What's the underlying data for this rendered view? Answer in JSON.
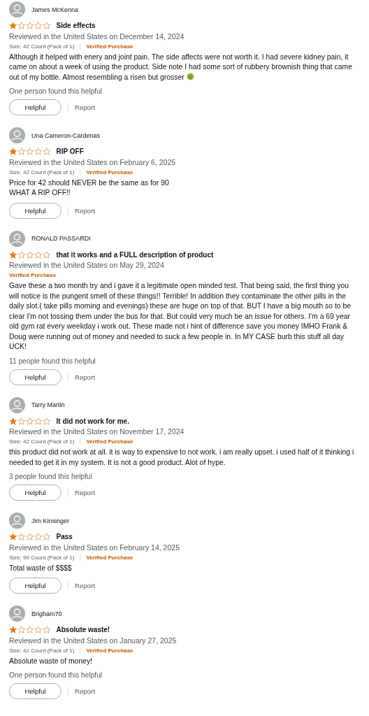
{
  "reviews": [
    {
      "name": "James McKenna",
      "stars": 1,
      "title": "Side effects",
      "date": "Reviewed in the United States on December 14, 2024",
      "size": "Size: 42 Count (Pack of 1)",
      "badge": "Verified Purchase",
      "body": "Although it helped with enery and joint pain. The side affects were not worth it. I had severe kidney pain, it came on about a week of using the product. Side note I had some sort of rubbery brownish thing that came out of my bottle. Almost resembling a risen but grosser",
      "sick_face": true,
      "helpful_count": "One person found this helpful",
      "helpful_button": "Helpful",
      "report_link": "Report"
    },
    {
      "name": "Una Cameron-Cardenas",
      "stars": 1,
      "title": "RIP OFF",
      "date": "Reviewed in the United States on February 6, 2025",
      "size": "Size: 42 Count (Pack of 1)",
      "badge": "Verified Purchase",
      "body": "Price for 42 should NEVER be the same as for 90\nWHAT A RIP OFF!!",
      "helpful_button": "Helpful",
      "report_link": "Report"
    },
    {
      "name": "RONALD PASSARDI",
      "stars": 1,
      "title": "that it works and a FULL description of product",
      "date": "Reviewed in the United States on May 29, 2024",
      "badge": "Verified Purchase",
      "body": "Gave these a two month try and i gave it a legitimate open minded test. That being said, the first thing you will notice is the pungent smell of these things!! Terrible! In addition they contaminate the other pills in the daily slot.( take pills morning and evenings) these are huge on top of that. BUT I have a big mouth so to be clear I'm not tossing them under the bus for that. But could very much be an issue for others. I'm a 69 year old gym rat every weekday i work out. These made not i hint of difference save you money IMHO Frank & Doug were running out of money and needed to suck a few people in. In MY CASE burb this stuff all day UCK!",
      "helpful_count": "11 people found this helpful",
      "helpful_button": "Helpful",
      "report_link": "Report"
    },
    {
      "name": "Tarry Martin",
      "stars": 1,
      "title": "It did not work for me.",
      "date": "Reviewed in the United States on November 17, 2024",
      "size": "Size: 42 Count (Pack of 1)",
      "badge": "Verified Purchase",
      "body": "this product did not work at all. it is way to expensive to not work. i am really upset. i used half of it thinking i needed to get it in my system. It is not a good product. Alot of hype.",
      "helpful_count": "3 people found this helpful",
      "helpful_button": "Helpful",
      "report_link": "Report"
    },
    {
      "name": "Jim Kinsinger",
      "stars": 1,
      "title": "Pass",
      "date": "Reviewed in the United States on February 14, 2025",
      "size": "Size: 90 Count (Pack of 1)",
      "badge": "Verified Purchase",
      "body": "Total waste of $$$$",
      "helpful_button": "Helpful",
      "report_link": "Report"
    },
    {
      "name": "Brigham70",
      "stars": 1,
      "title": "Absolute waste!",
      "date": "Reviewed in the United States on January 27, 2025",
      "size": "Size: 42 Count (Pack of 1)",
      "badge": "Verified Purchase",
      "body": "Absolute waste of money!",
      "helpful_count": "One person found this helpful",
      "helpful_button": "Helpful",
      "report_link": "Report"
    }
  ]
}
